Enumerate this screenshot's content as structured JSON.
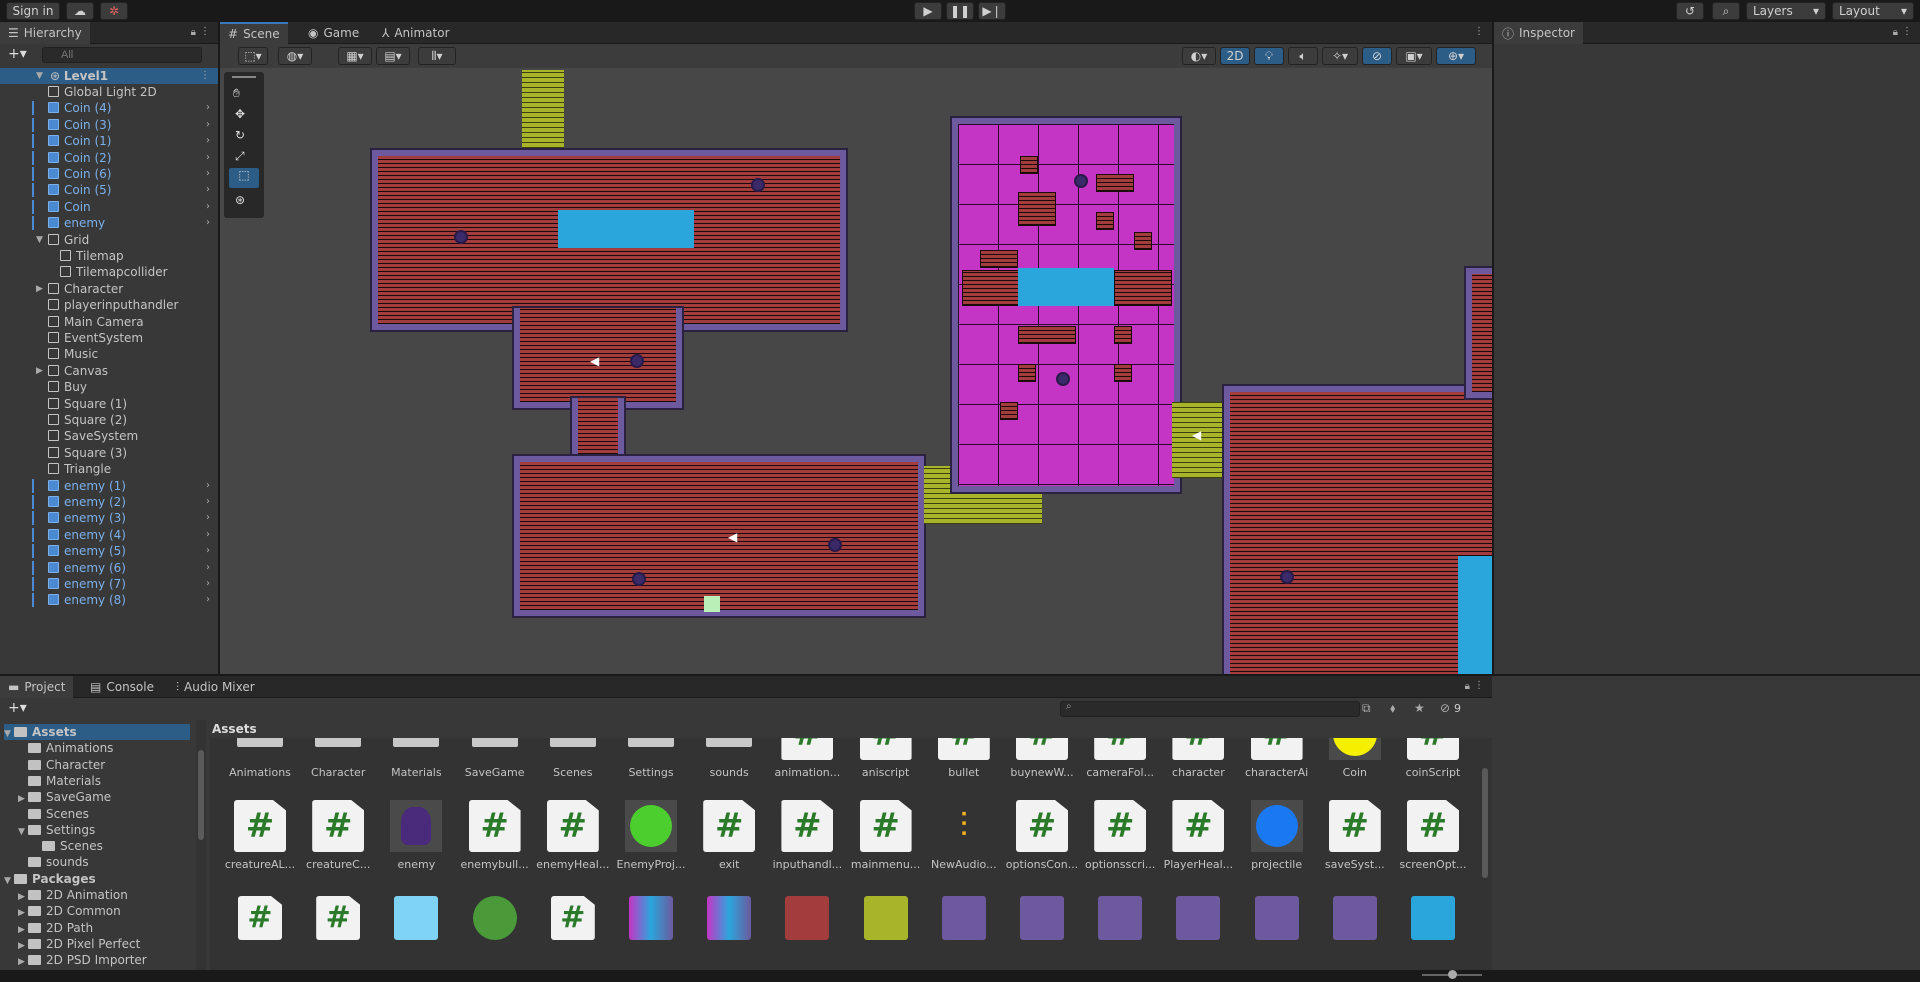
{
  "toolbar": {
    "sign_in": "Sign in",
    "layers": "Layers",
    "layout": "Layout"
  },
  "hierarchy": {
    "tab": "Hierarchy",
    "search_placeholder": "All",
    "root": "Level1",
    "items": [
      {
        "label": "Global Light 2D",
        "prefab": false
      },
      {
        "label": "Coin (4)",
        "prefab": true
      },
      {
        "label": "Coin (3)",
        "prefab": true
      },
      {
        "label": "Coin (1)",
        "prefab": true
      },
      {
        "label": "Coin (2)",
        "prefab": true
      },
      {
        "label": "Coin (6)",
        "prefab": true
      },
      {
        "label": "Coin (5)",
        "prefab": true
      },
      {
        "label": "Coin",
        "prefab": true
      },
      {
        "label": "enemy",
        "prefab": true
      },
      {
        "label": "Grid",
        "prefab": false
      },
      {
        "label": "Tilemap",
        "prefab": false
      },
      {
        "label": "Tilemapcollider",
        "prefab": false
      },
      {
        "label": "Character",
        "prefab": false
      },
      {
        "label": "playerinputhandler",
        "prefab": false
      },
      {
        "label": "Main Camera",
        "prefab": false
      },
      {
        "label": "EventSystem",
        "prefab": false
      },
      {
        "label": "Music",
        "prefab": false
      },
      {
        "label": "Canvas",
        "prefab": false
      },
      {
        "label": "Buy",
        "prefab": false
      },
      {
        "label": "Square (1)",
        "prefab": false
      },
      {
        "label": "Square (2)",
        "prefab": false
      },
      {
        "label": "SaveSystem",
        "prefab": false
      },
      {
        "label": "Square (3)",
        "prefab": false
      },
      {
        "label": "Triangle",
        "prefab": false
      },
      {
        "label": "enemy (1)",
        "prefab": true
      },
      {
        "label": "enemy (2)",
        "prefab": true
      },
      {
        "label": "enemy (3)",
        "prefab": true
      },
      {
        "label": "enemy (4)",
        "prefab": true
      },
      {
        "label": "enemy (5)",
        "prefab": true
      },
      {
        "label": "enemy (6)",
        "prefab": true
      },
      {
        "label": "enemy (7)",
        "prefab": true
      },
      {
        "label": "enemy (8)",
        "prefab": true
      }
    ]
  },
  "scene_tabs": {
    "scene": "Scene",
    "game": "Game",
    "animator": "Animator",
    "mode_2d": "2D"
  },
  "inspector": {
    "tab": "Inspector"
  },
  "project": {
    "tab_project": "Project",
    "tab_console": "Console",
    "tab_audio": "Audio Mixer",
    "breadcrumb": "Assets",
    "filter_count": "9",
    "tree": [
      {
        "label": "Assets",
        "level": 0,
        "bold": true
      },
      {
        "label": "Animations",
        "level": 1
      },
      {
        "label": "Character",
        "level": 1
      },
      {
        "label": "Materials",
        "level": 1
      },
      {
        "label": "SaveGame",
        "level": 1
      },
      {
        "label": "Scenes",
        "level": 1
      },
      {
        "label": "Settings",
        "level": 1
      },
      {
        "label": "Scenes",
        "level": 2
      },
      {
        "label": "sounds",
        "level": 1
      },
      {
        "label": "Packages",
        "level": 0,
        "bold": true
      },
      {
        "label": "2D Animation",
        "level": 1
      },
      {
        "label": "2D Common",
        "level": 1
      },
      {
        "label": "2D Path",
        "level": 1
      },
      {
        "label": "2D Pixel Perfect",
        "level": 1
      },
      {
        "label": "2D PSD Importer",
        "level": 1
      }
    ],
    "row1": [
      "Animations",
      "Character",
      "Materials",
      "SaveGame",
      "Scenes",
      "Settings",
      "sounds",
      "animation...",
      "aniscript",
      "bullet",
      "buynewW...",
      "cameraFol...",
      "character",
      "characterAi",
      "Coin",
      "coinScript"
    ],
    "row2": [
      "creatureAL...",
      "creatureC...",
      "enemy",
      "enemybull...",
      "enemyHeal...",
      "EnemyProj...",
      "exit",
      "inputhandl...",
      "mainmenu...",
      "NewAudio...",
      "optionsCon...",
      "optionsscri...",
      "PlayerHeal...",
      "projectile",
      "saveSyst...",
      "screenOpt..."
    ]
  }
}
